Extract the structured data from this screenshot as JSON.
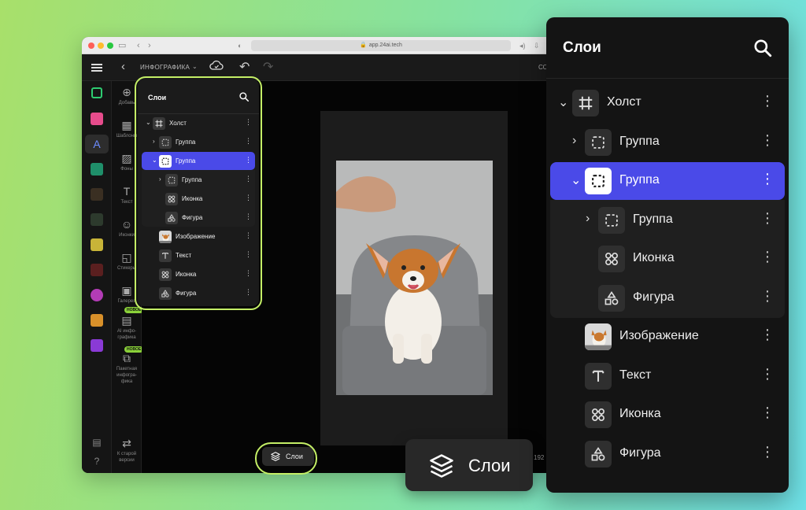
{
  "browser": {
    "url": "app.24ai.tech"
  },
  "appbar": {
    "title": "ИНФОГРАФИКА",
    "right_label": "СО"
  },
  "tools": [
    {
      "icon": "⊕",
      "label": "Добавь"
    },
    {
      "icon": "▦",
      "label": "Шаблоны"
    },
    {
      "icon": "▨",
      "label": "Фоны"
    },
    {
      "icon": "T",
      "label": "Текст"
    },
    {
      "icon": "☺",
      "label": "Иконки"
    },
    {
      "icon": "◱",
      "label": "Стикеры"
    },
    {
      "icon": "▣",
      "label": "Галерея"
    },
    {
      "icon": "▤",
      "label": "AI инфо-графика",
      "badge": "НОВОЕ"
    },
    {
      "icon": "⧉",
      "label": "Пакетная инфогра-фика",
      "badge": "НОВОЕ"
    }
  ],
  "tools_bottom": {
    "icon": "⇄",
    "label": "К старой версии"
  },
  "bottom_readout": "192",
  "layers_button": {
    "label": "Слои"
  },
  "layers_panel": {
    "title": "Слои",
    "rows": [
      {
        "label": "Холст",
        "icon": "frame-icon",
        "level": 0,
        "chevron": "⌄"
      },
      {
        "label": "Группа",
        "icon": "group-icon",
        "level": 1,
        "chevron": "›"
      },
      {
        "label": "Группа",
        "icon": "group-icon",
        "level": 1,
        "chevron": "⌄",
        "selected": true
      },
      {
        "label": "Группа",
        "icon": "group-icon",
        "level": 2,
        "chevron": "›"
      },
      {
        "label": "Иконка",
        "icon": "component-icon",
        "level": 2
      },
      {
        "label": "Фигура",
        "icon": "shapes-icon",
        "level": 2
      },
      {
        "label": "Изображение",
        "icon": "image-thumbnail",
        "level": 1
      },
      {
        "label": "Текст",
        "icon": "text-icon",
        "level": 1
      },
      {
        "label": "Иконка",
        "icon": "component-icon",
        "level": 1
      },
      {
        "label": "Фигура",
        "icon": "shapes-icon",
        "level": 1
      }
    ]
  },
  "colors": {
    "selection": "#4a4ae8",
    "highlight": "#c4ef66",
    "badge": "#8bd13a"
  }
}
